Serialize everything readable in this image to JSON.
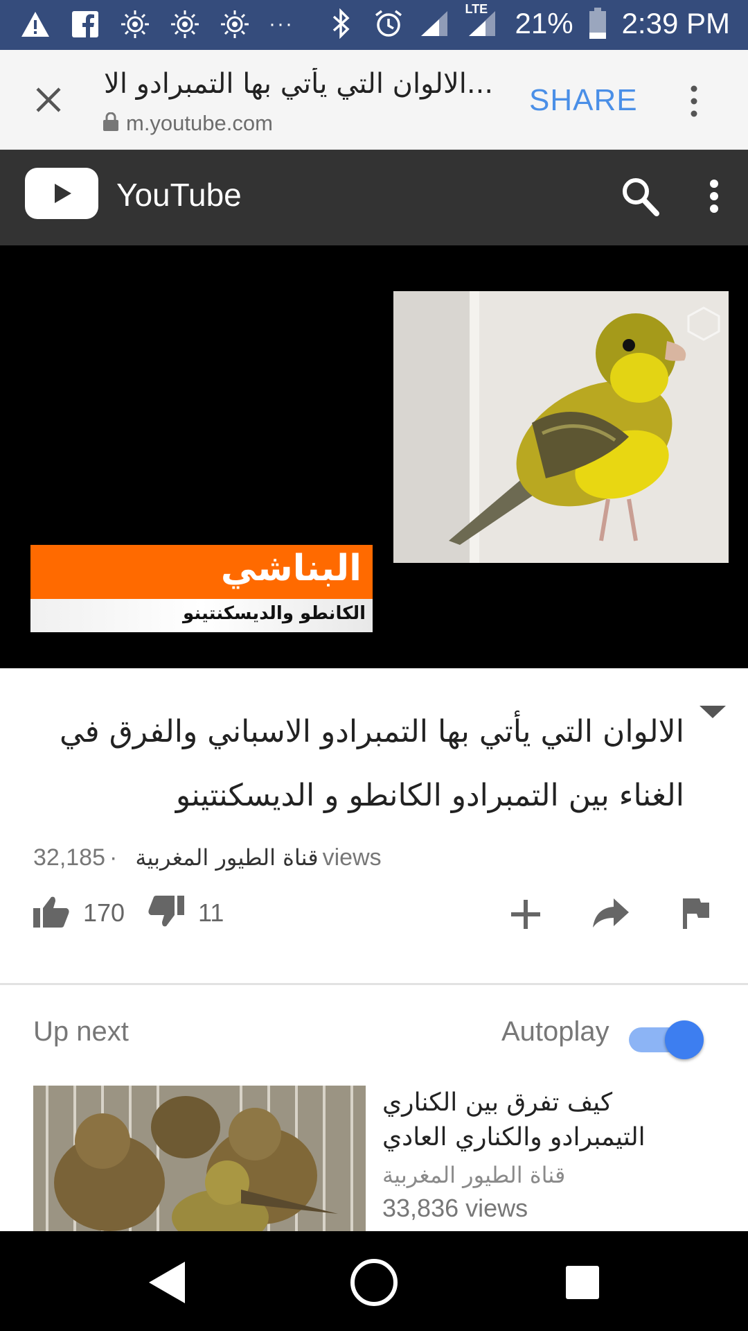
{
  "status_bar": {
    "battery_pct": "21%",
    "time": "2:39 PM",
    "network": "LTE",
    "overflow": "···",
    "icons": [
      "warning-icon",
      "facebook-icon",
      "spiral-icon",
      "spiral-icon",
      "spiral-icon",
      "bluetooth-icon",
      "alarm-icon",
      "signal-icon",
      "battery-icon"
    ]
  },
  "custom_tab": {
    "title": "الالوان التي يأتي بها التمبرادو الا...",
    "url": "m.youtube.com",
    "share_label": "SHARE",
    "icons": [
      "close-icon",
      "lock-icon",
      "more-vert-icon"
    ]
  },
  "youtube_header": {
    "brand": "YouTube",
    "icons": [
      "youtube-logo-icon",
      "search-icon",
      "more-vert-icon"
    ]
  },
  "player": {
    "overlay_title": "البناشي",
    "overlay_subtitle": "الكانطو والديسكنتينو",
    "colors": {
      "orange": "#ff6a00",
      "background": "#000000"
    }
  },
  "video": {
    "title": "الالوان التي يأتي بها التمبرادو الاسباني والفرق في الغناء بين التمبرادو الكانطو و الديسكنتينو",
    "views_count": "32,185",
    "separator": "·",
    "channel": "قناة الطيور المغربية",
    "views_word": "views",
    "likes": "170",
    "dislikes": "11",
    "icons": [
      "like-icon",
      "dislike-icon",
      "add-icon",
      "share-icon",
      "flag-icon",
      "collapse-arrow-icon"
    ]
  },
  "up_next": {
    "label": "Up next",
    "autoplay_label": "Autoplay",
    "autoplay_on": true,
    "accent": "#3d7ef0",
    "item": {
      "title": "كيف تفرق بين الكناري التيمبرادو والكناري العادي",
      "channel": "قناة الطيور المغربية",
      "views": "33,836 views"
    }
  },
  "nav_bar": {
    "icons": [
      "back-icon",
      "home-icon",
      "recents-icon"
    ]
  }
}
